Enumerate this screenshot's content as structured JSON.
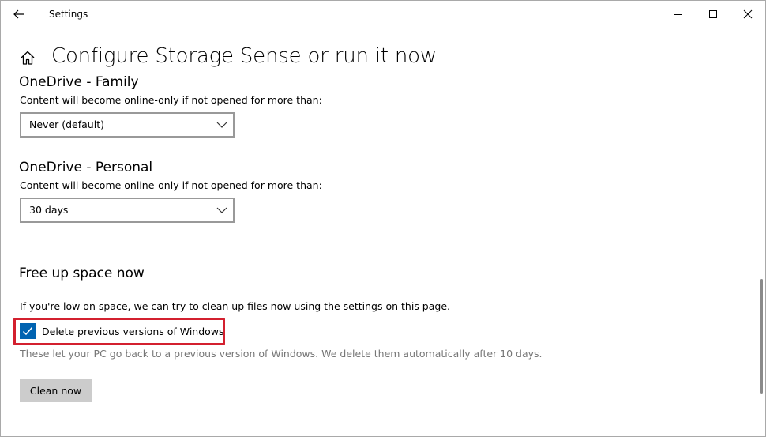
{
  "window": {
    "title": "Settings"
  },
  "page": {
    "title": "Configure Storage Sense or run it now"
  },
  "onedrive_family": {
    "title": "OneDrive - Family",
    "description": "Content will become online-only if not opened for more than:",
    "selected": "Never (default)"
  },
  "onedrive_personal": {
    "title": "OneDrive - Personal",
    "description": "Content will become online-only if not opened for more than:",
    "selected": "30 days"
  },
  "free_up": {
    "title": "Free up space now",
    "description": "If you're low on space, we can try to clean up files now using the settings on this page.",
    "checkbox_label": "Delete previous versions of Windows",
    "checkbox_checked": true,
    "checkbox_help": "These let your PC go back to a previous version of Windows. We delete them automatically after 10 days.",
    "button_label": "Clean now"
  },
  "colors": {
    "accent": "#0063b1",
    "highlight": "#d3202f",
    "button_bg": "#cccccc",
    "secondary_text": "#767676"
  }
}
